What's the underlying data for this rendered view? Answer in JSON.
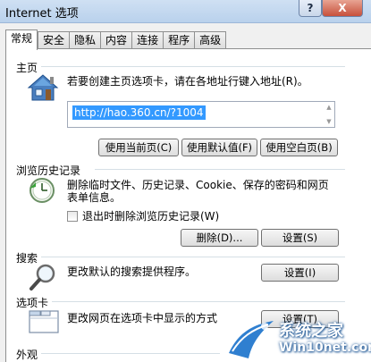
{
  "window": {
    "title": "Internet 选项",
    "help_label": "?",
    "close_label": "X"
  },
  "tabs": [
    "常规",
    "安全",
    "隐私",
    "内容",
    "连接",
    "程序",
    "高级"
  ],
  "homepage": {
    "group_label": "主页",
    "description": "若要创建主页选项卡，请在各地址行键入地址(R)。",
    "url": "http://hao.360.cn/?1004",
    "buttons": {
      "use_current": "使用当前页(C)",
      "use_default": "使用默认值(F)",
      "use_blank": "使用空白页(B)"
    }
  },
  "history": {
    "group_label": "浏览历史记录",
    "description_line1": "删除临时文件、历史记录、Cookie、保存的密码和网页",
    "description_line2": "表单信息。",
    "checkbox_label": "退出时删除浏览历史记录(W)",
    "checkbox_checked": false,
    "buttons": {
      "delete": "删除(D)...",
      "settings": "设置(S)"
    }
  },
  "search": {
    "group_label": "搜索",
    "description": "更改默认的搜索提供程序。",
    "buttons": {
      "settings": "设置(I)"
    }
  },
  "tabs_section": {
    "group_label": "选项卡",
    "description": "更改网页在选项卡中显示的方式",
    "buttons": {
      "settings": "设置(T)"
    }
  },
  "appearance": {
    "group_label": "外观"
  },
  "watermark": {
    "main": "系统之家",
    "sub": "Win10net.com"
  },
  "colors": {
    "selection": "#3399ff",
    "titlebar": "#c4d9f0",
    "close": "#c7503b"
  }
}
